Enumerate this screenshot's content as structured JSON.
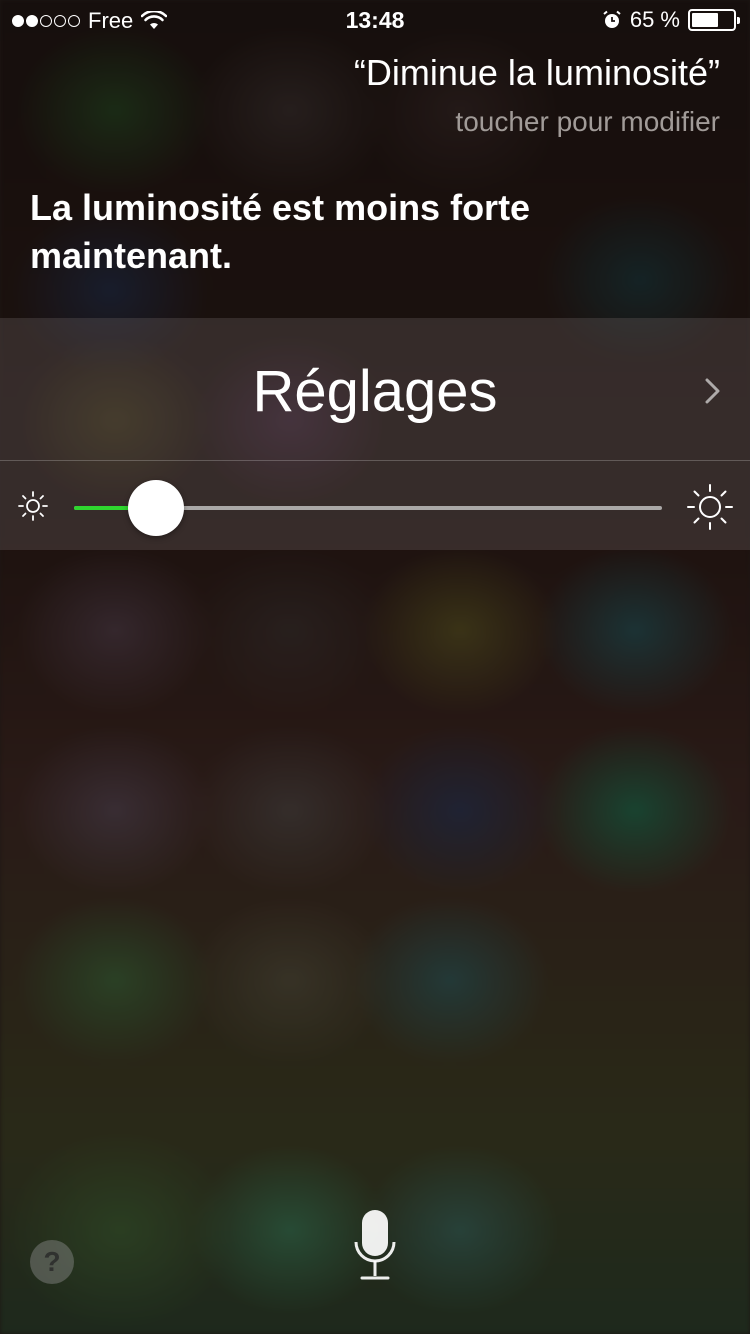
{
  "status_bar": {
    "signal_filled": 2,
    "signal_total": 5,
    "carrier": "Free",
    "time": "13:48",
    "battery_percent_label": "65 %",
    "battery_level": 0.65
  },
  "siri": {
    "query": "“Diminue la luminosité”",
    "tap_to_edit": "toucher pour modifier",
    "response": "La luminosité est moins forte maintenant."
  },
  "settings_card": {
    "title": "Réglages",
    "brightness_level": 0.14,
    "accent_color": "#2fd62f"
  },
  "bottom": {
    "help_label": "?",
    "help_icon": "question-icon",
    "mic_icon": "microphone-icon"
  }
}
